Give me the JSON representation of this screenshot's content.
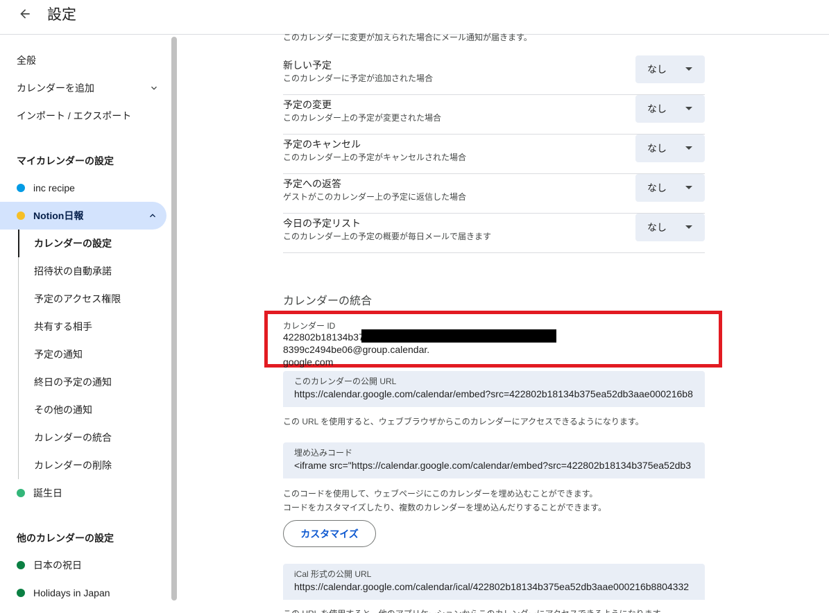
{
  "header": {
    "title": "設定"
  },
  "sidebar": {
    "general": "全般",
    "add_calendar": "カレンダーを追加",
    "import_export": "インポート / エクスポート",
    "my_calendars_heading": "マイカレンダーの設定",
    "my_calendars": [
      {
        "name": "inc recipe",
        "color": "#039be5"
      },
      {
        "name": "Notion日報",
        "color": "#f6bf26"
      }
    ],
    "sub_items": [
      "カレンダーの設定",
      "招待状の自動承諾",
      "予定のアクセス権限",
      "共有する相手",
      "予定の通知",
      "終日の予定の通知",
      "その他の通知",
      "カレンダーの統合",
      "カレンダーの削除"
    ],
    "birthday": {
      "name": "誕生日",
      "color": "#33b679"
    },
    "other_calendars_heading": "他のカレンダーの設定",
    "other_calendars": [
      {
        "name": "日本の祝日",
        "color": "#0b8043"
      },
      {
        "name": "Holidays in Japan",
        "color": "#0b8043"
      }
    ]
  },
  "main": {
    "faded_top": "このカレンダーに変更が加えられた場合にメール通知が届きます。",
    "notifications": [
      {
        "title": "新しい予定",
        "desc": "このカレンダーに予定が追加された場合",
        "value": "なし"
      },
      {
        "title": "予定の変更",
        "desc": "このカレンダー上の予定が変更された場合",
        "value": "なし"
      },
      {
        "title": "予定のキャンセル",
        "desc": "このカレンダー上の予定がキャンセルされた場合",
        "value": "なし"
      },
      {
        "title": "予定への返答",
        "desc": "ゲストがこのカレンダー上の予定に返信した場合",
        "value": "なし"
      },
      {
        "title": "今日の予定リスト",
        "desc": "このカレンダー上の予定の概要が毎日メールで届きます",
        "value": "なし"
      }
    ],
    "integration_title": "カレンダーの統合",
    "calendar_id_label": "カレンダー ID",
    "calendar_id_prefix": "422802b18134b37",
    "calendar_id_suffix": "8399c2494be06@group.calendar.",
    "calendar_id_line2": "google.com",
    "public_url_label": "このカレンダーの公開 URL",
    "public_url_value": "https://calendar.google.com/calendar/embed?src=422802b18134b375ea52db3aae000216b8",
    "public_url_help": "この URL を使用すると、ウェブブラウザからこのカレンダーにアクセスできるようになります。",
    "embed_label": "埋め込みコード",
    "embed_value": "<iframe src=\"https://calendar.google.com/calendar/embed?src=422802b18134b375ea52db3",
    "embed_help1": "このコードを使用して、ウェブページにこのカレンダーを埋め込むことができます。",
    "embed_help2": "コードをカスタマイズしたり、複数のカレンダーを埋め込んだりすることができます。",
    "customize_button": "カスタマイズ",
    "ical_label": "iCal 形式の公開 URL",
    "ical_value": "https://calendar.google.com/calendar/ical/422802b18134b375ea52db3aae000216b8804332",
    "ical_help": "この URL を使用すると、他のアプリケーションからこのカレンダーにアクセスできるようになります。"
  }
}
